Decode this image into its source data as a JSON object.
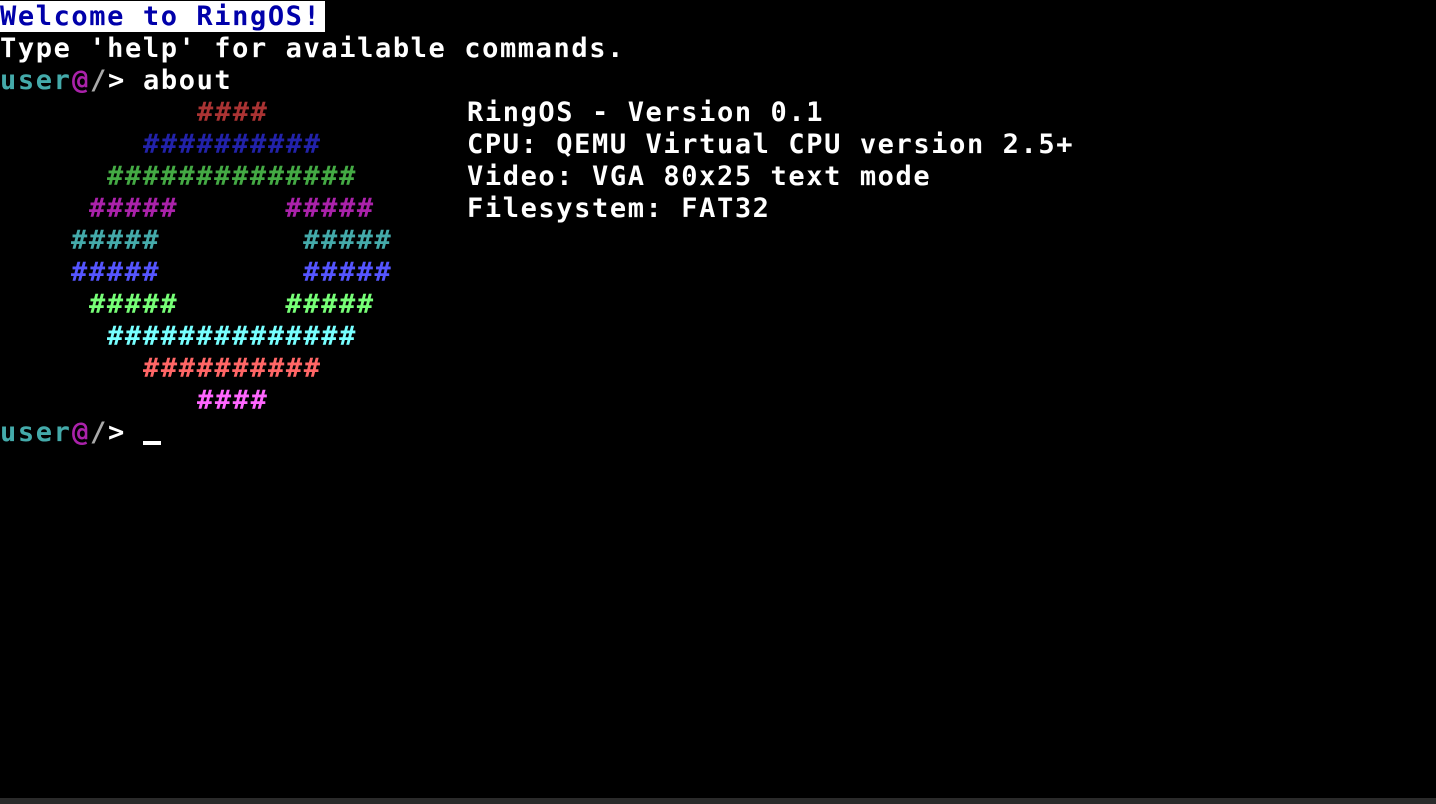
{
  "banner": "Welcome to RingOS!",
  "help_line": "Type 'help' for available commands.",
  "prompt": {
    "user": "user",
    "at": "@",
    "path": "/",
    "arrow": ">"
  },
  "command": "about",
  "logo": [
    {
      "text": "####",
      "color": "#aa3333"
    },
    {
      "text": "##########",
      "color": "#2222aa"
    },
    {
      "text": "##############",
      "color": "#44aa44"
    },
    {
      "text": "#####      #####",
      "color": "#aa22aa"
    },
    {
      "text": "#####        #####",
      "color": "#44aaaa"
    },
    {
      "text": "#####        #####",
      "color": "#5555ff"
    },
    {
      "text": "#####      #####",
      "color": "#77ff77"
    },
    {
      "text": "##############",
      "color": "#77ffff"
    },
    {
      "text": "##########",
      "color": "#ff6666"
    },
    {
      "text": "####",
      "color": "#ff66ff"
    }
  ],
  "info": [
    "RingOS - Version 0.1",
    "CPU: QEMU Virtual CPU version 2.5+",
    "Video: VGA 80x25 text mode",
    "Filesystem: FAT32"
  ],
  "colors": {
    "background": "#000000",
    "text": "#ffffff",
    "prompt_user": "#44aaaa",
    "prompt_at": "#aa22aa",
    "prompt_path": "#aaaaaa",
    "banner_bg": "#ffffff",
    "banner_fg": "#0000aa"
  }
}
